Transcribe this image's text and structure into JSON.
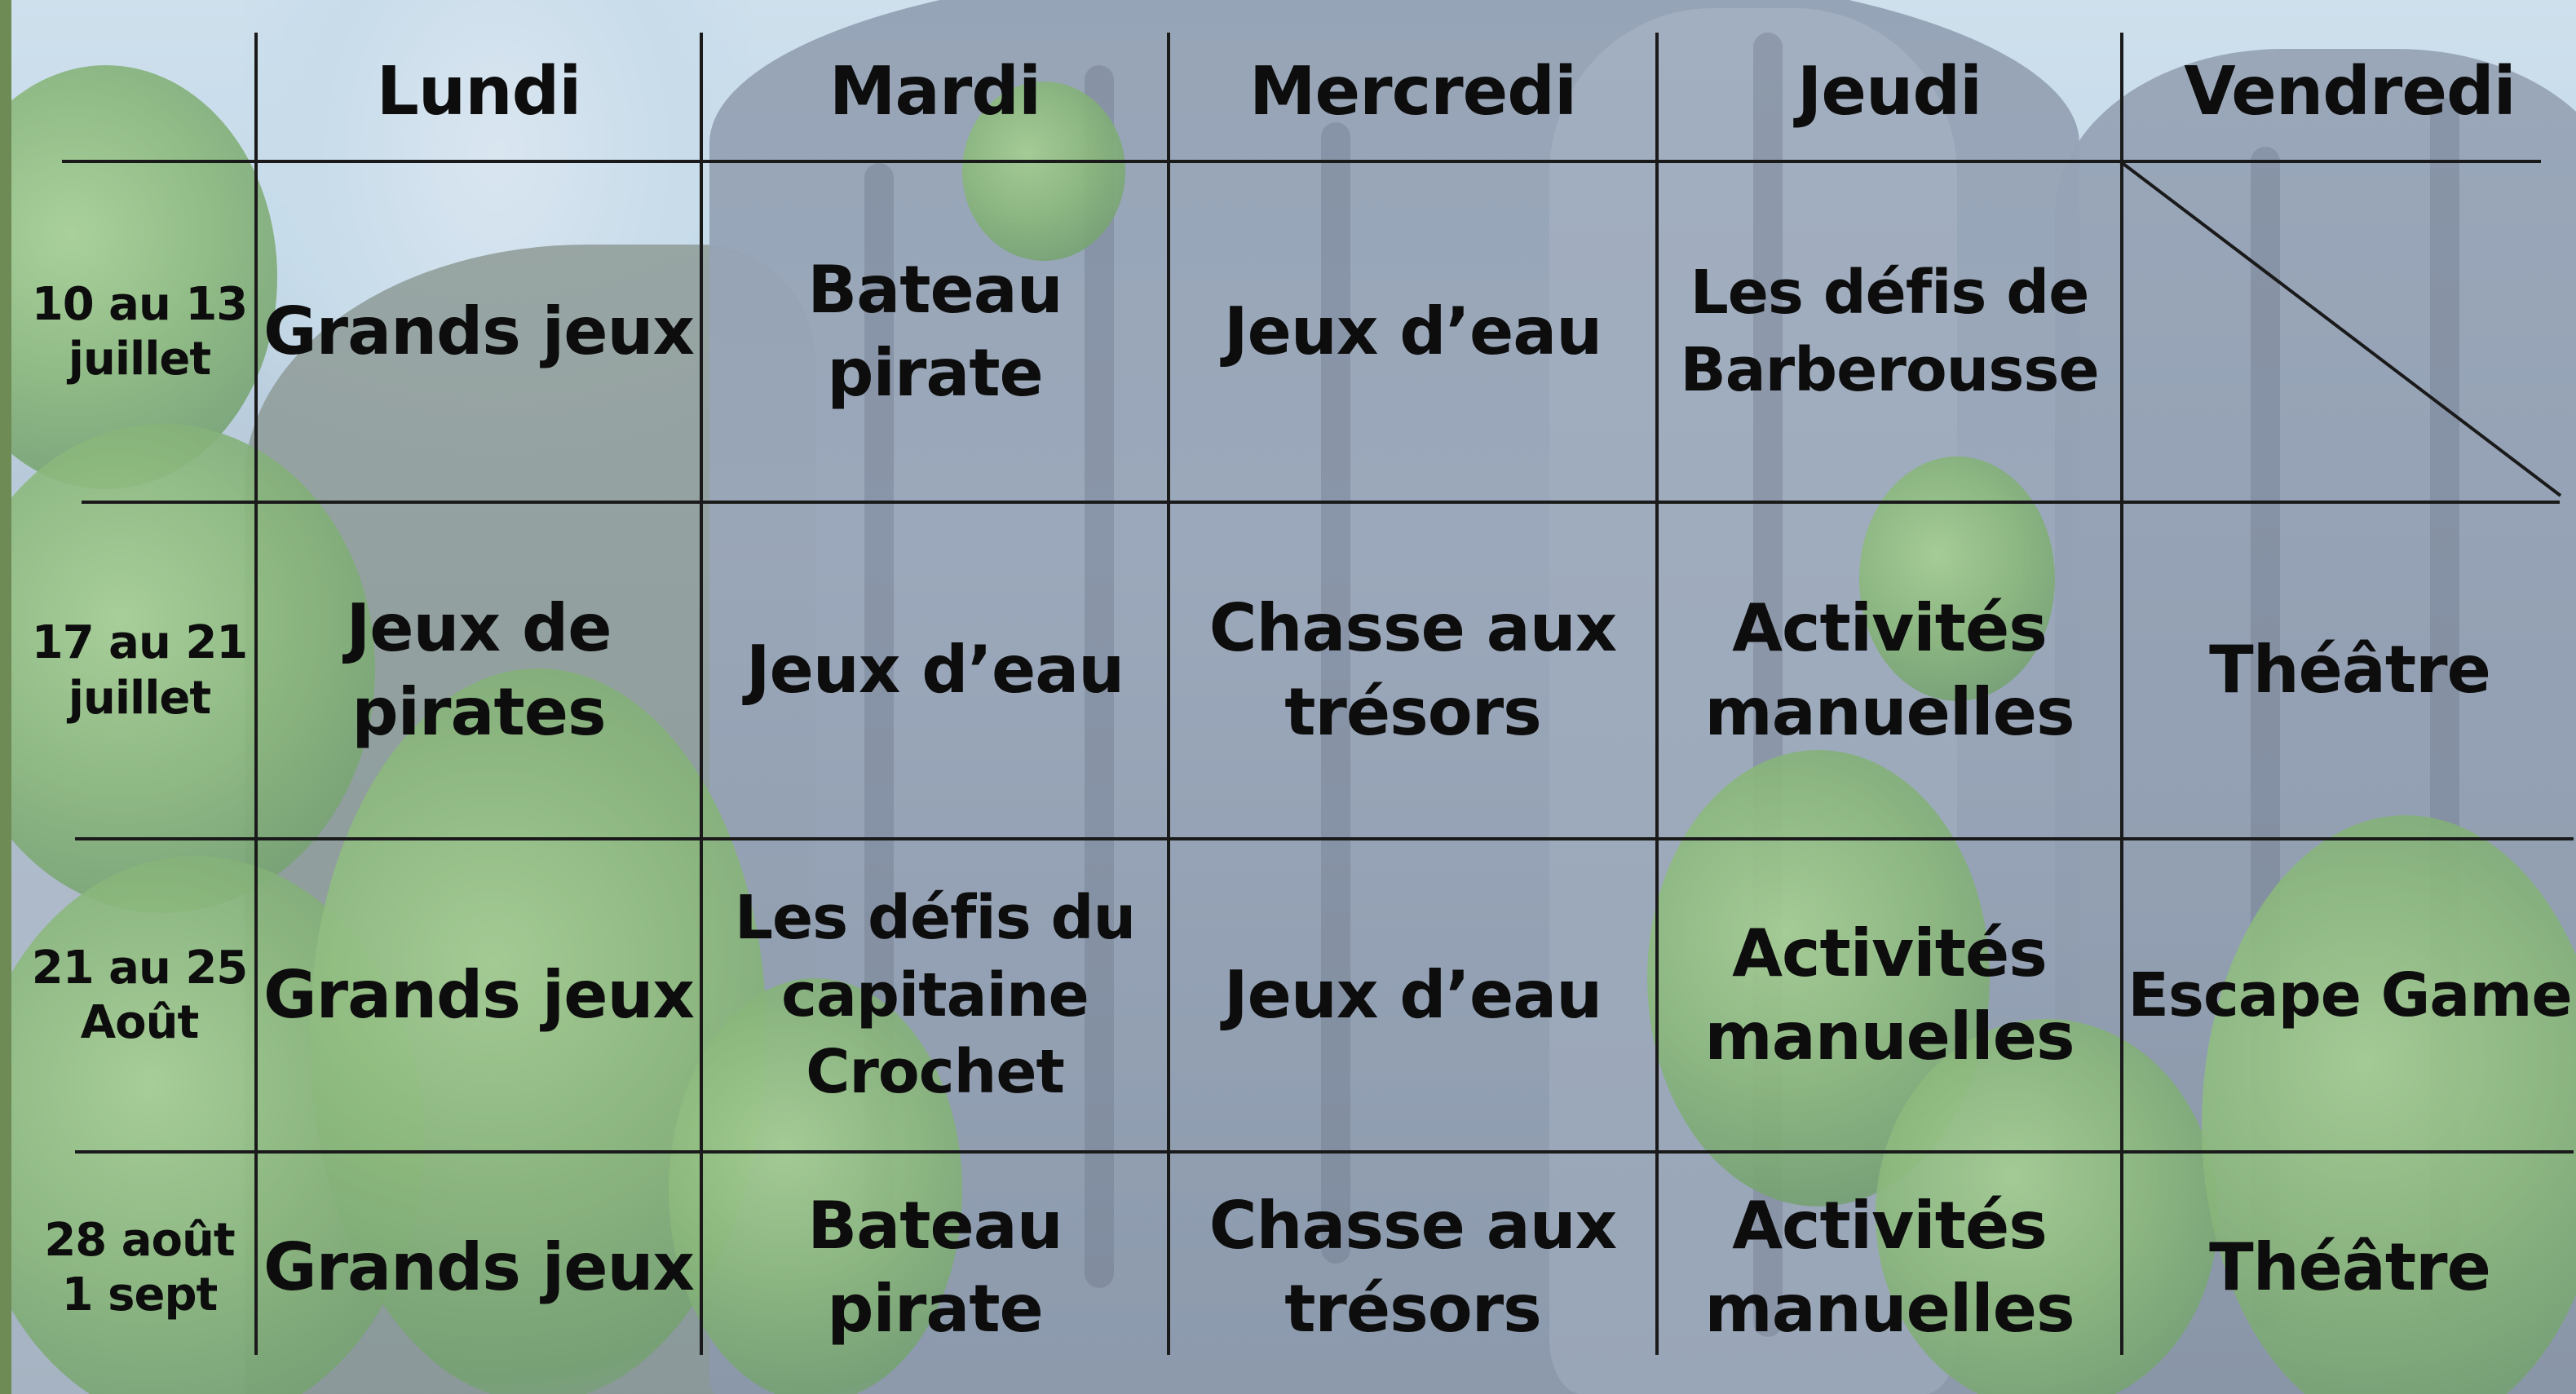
{
  "days": [
    "Lundi",
    "Mardi",
    "Mercredi",
    "Jeudi",
    "Vendredi"
  ],
  "weeks": [
    {
      "label": "10 au 13\njuillet",
      "activities": [
        "Grands jeux",
        "Bateau\npirate",
        "Jeux d’eau",
        "Les défis de\nBarberousse",
        ""
      ]
    },
    {
      "label": "17 au 21\njuillet",
      "activities": [
        "Jeux de\npirates",
        "Jeux d’eau",
        "Chasse aux\ntrésors",
        "Activités\nmanuelles",
        "Théâtre"
      ]
    },
    {
      "label": "21 au 25\nAoût",
      "activities": [
        "Grands jeux",
        "Les défis du\ncapitaine\nCrochet",
        "Jeux d’eau",
        "Activités\nmanuelles",
        "Escape Game"
      ]
    },
    {
      "label": "28 août\n1 sept",
      "activities": [
        "Grands jeux",
        "Bateau\npirate",
        "Chasse aux\ntrésors",
        "Activités\nmanuelles",
        "Théâtre"
      ]
    }
  ],
  "colors": {
    "grid_line": "#1a1a1a",
    "text": "#0d0d0d"
  }
}
